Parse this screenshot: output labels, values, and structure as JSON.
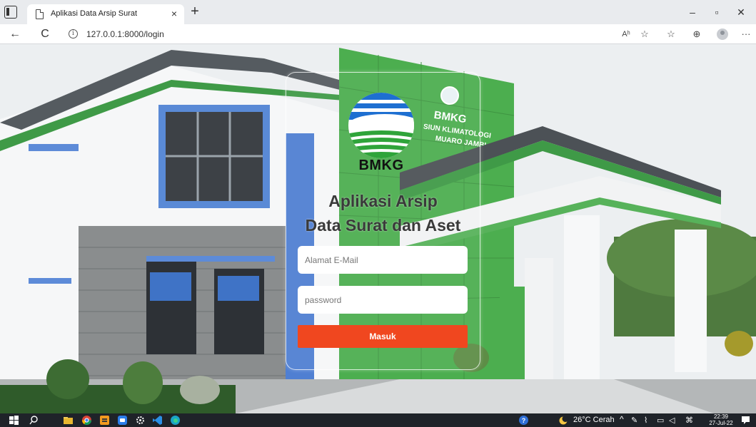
{
  "browser": {
    "tab_title": "Aplikasi Data Arsip Surat",
    "tab_close": "×",
    "new_tab": "+",
    "url": "127.0.0.1:8000/login",
    "window_buttons": {
      "minimize": "–",
      "restore": "▫",
      "close": "✕"
    },
    "nav": {
      "back": "←",
      "refresh": "C"
    },
    "toolbar": {
      "read_aloud": "Aʰ",
      "more": "···"
    }
  },
  "login": {
    "logo_text": "BMKG",
    "headline_line1": "Aplikasi Arsip",
    "headline_line2": "Data Surat dan Aset",
    "email_placeholder": "Alamat E-Mail",
    "password_placeholder": "password",
    "submit_label": "Masuk",
    "submit_color": "#f0471f"
  },
  "background": {
    "sign_title": "BMKG",
    "sign_line1": "SIUN KLIMATOLOGI",
    "sign_line2": "MUARO JAMBI"
  },
  "taskbar": {
    "weather": "26°C  Cerah",
    "time": "22:39",
    "date": "27-Jul-22"
  }
}
